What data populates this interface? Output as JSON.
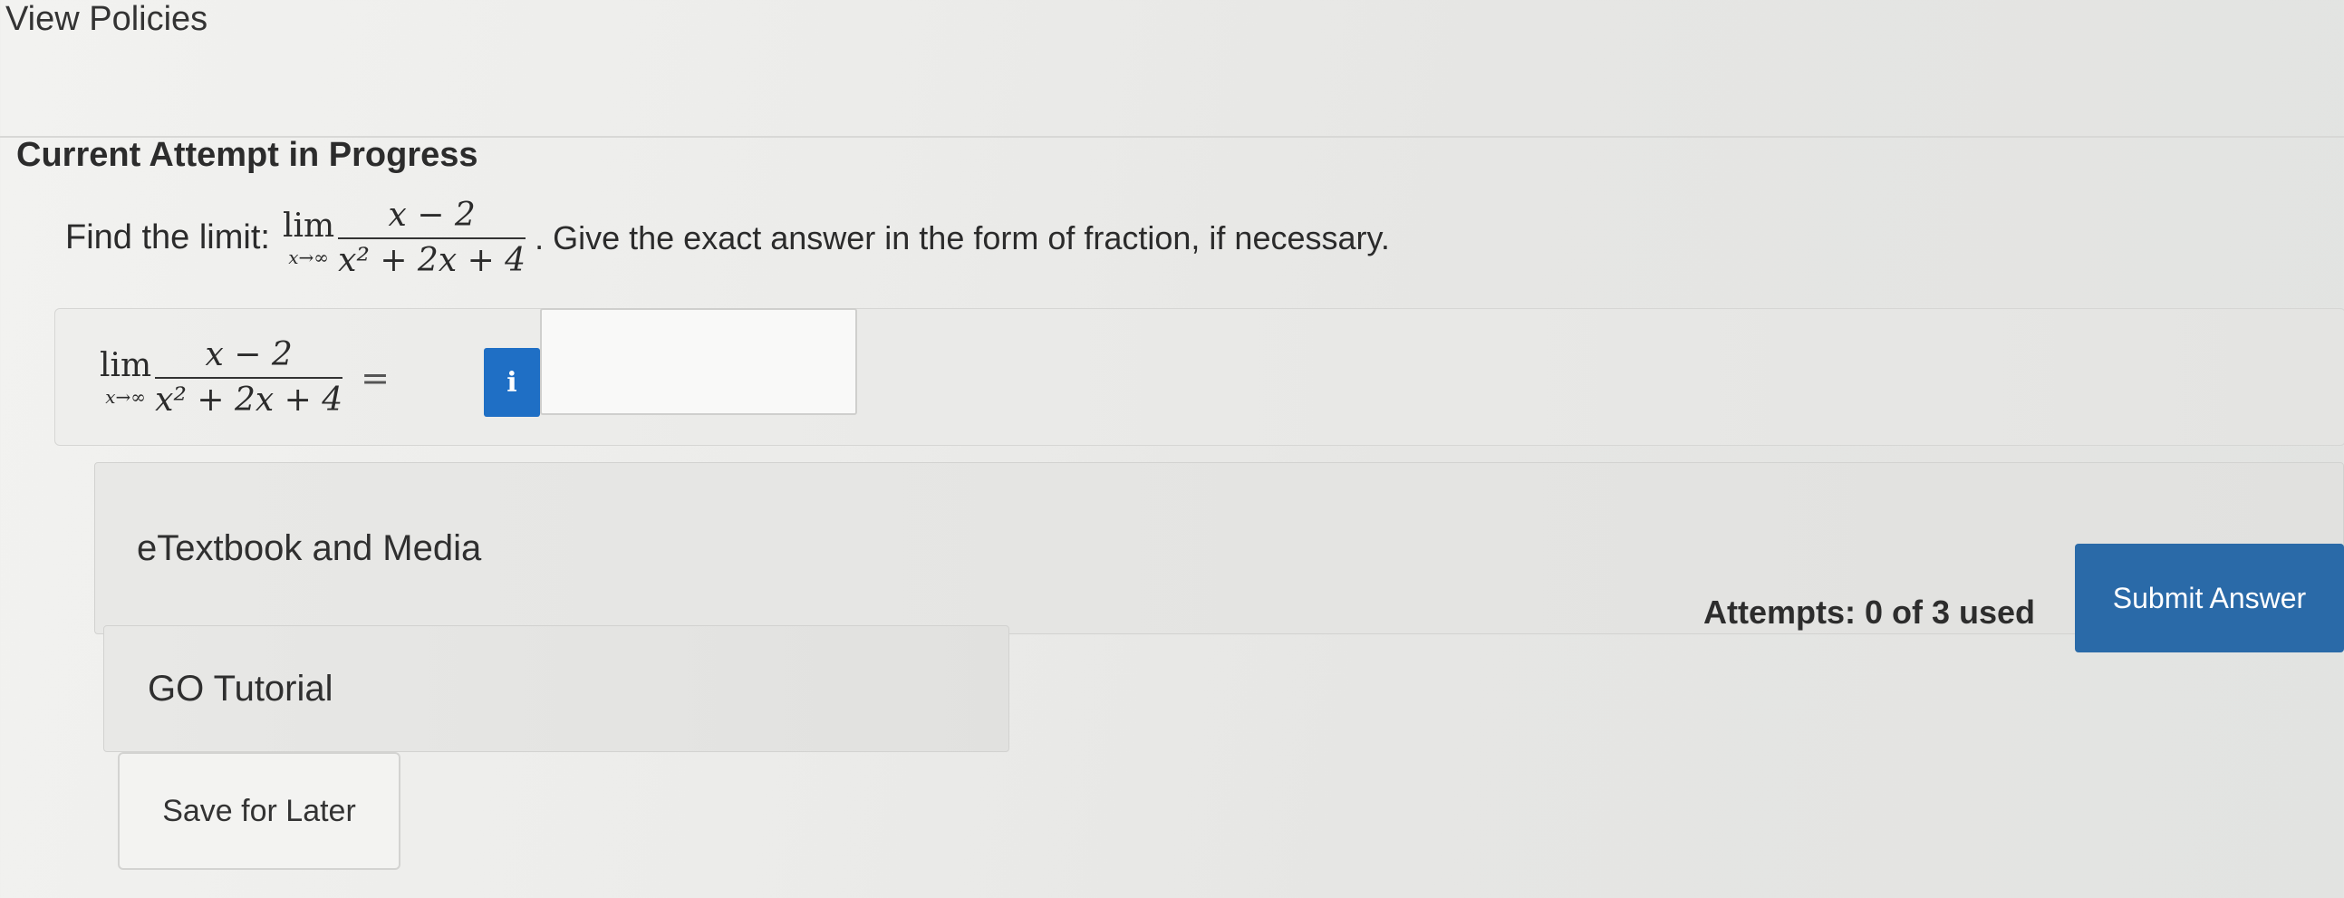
{
  "header": {
    "view_policies": "View Policies"
  },
  "attempt": {
    "title": "Current Attempt in Progress"
  },
  "question": {
    "prefix": "Find the limit:",
    "lim": "lim",
    "lim_sub": "x→∞",
    "numerator": "x − 2",
    "denominator": "x² + 2x + 4",
    "suffix": ". Give the exact answer in the form of fraction, if necessary."
  },
  "answer": {
    "lim": "lim",
    "lim_sub": "x→∞",
    "numerator": "x − 2",
    "denominator": "x² + 2x + 4",
    "equals": "=",
    "info_icon_glyph": "i",
    "input_value": ""
  },
  "sections": {
    "etextbook": "eTextbook and Media",
    "go_tutorial": "GO Tutorial"
  },
  "footer": {
    "attempts": "Attempts: 0 of 3 used",
    "submit_label": "Submit Answer",
    "save_label": "Save for Later"
  },
  "colors": {
    "info_button": "#1f6fc5",
    "submit_button": "#2a6aa8"
  }
}
